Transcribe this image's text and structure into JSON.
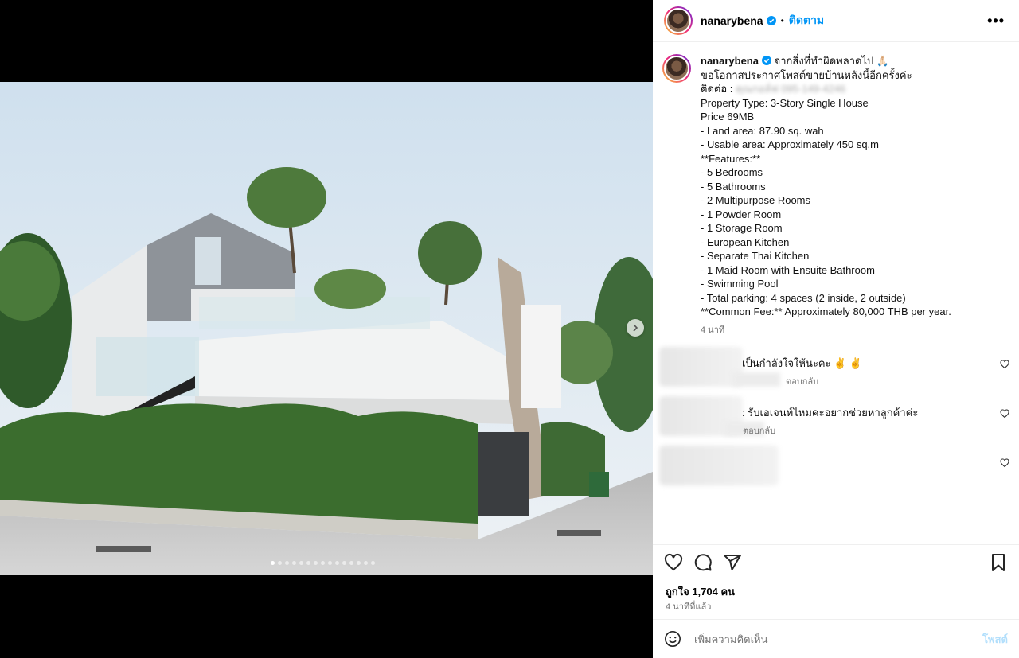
{
  "post": {
    "username": "nanarybena",
    "follow_label": "ติดตาม",
    "more_label": "•••",
    "dot_sep": "•"
  },
  "caption": {
    "lines": [
      "จากสิ่งที่ทำผิดพลาดไป 🙏🏻",
      "ขอโอกาสประกาศโพสต์ขายบ้านหลังนี้อีกครั้งค่ะ",
      "ติดต่อ :",
      "",
      "Property Type: 3-Story Single House",
      "Price 69MB",
      "",
      "- Land area: 87.90 sq. wah",
      "- Usable area: Approximately 450 sq.m",
      "",
      "**Features:**",
      "- 5 Bedrooms",
      "- 5 Bathrooms",
      "- 2 Multipurpose Rooms",
      "- 1 Powder Room",
      "- 1 Storage Room",
      "- European Kitchen",
      "- Separate Thai Kitchen",
      "- 1 Maid Room with Ensuite Bathroom",
      "- Swimming Pool",
      "- Total parking: 4 spaces (2 inside, 2 outside)",
      "",
      "**Common Fee:** Approximately 80,000 THB per year."
    ],
    "contact_blurred": "คุณกอล์ฟ 095-149-4246",
    "time": "4 นาที"
  },
  "comments": [
    {
      "text": "เป็นกำลังใจให้นะคะ ✌️ ✌️",
      "reply": "ตอบกลับ"
    },
    {
      "text": ": รับเอเจนท์ไหมคะอยากช่วยหาลูกค้าค่ะ",
      "reply": "ตอบกลับ"
    },
    {
      "text": "",
      "reply": ""
    }
  ],
  "stats": {
    "likes": "ถูกใจ 1,704 คน",
    "ago": "4 นาทีที่แล้ว"
  },
  "add_comment": {
    "placeholder": "เพิ่มความคิดเห็น",
    "post_label": "โพสต์"
  },
  "colors": {
    "accent": "#0095f6",
    "verified": "#0095f6",
    "post_disabled": "#b2dffc"
  },
  "icons": {
    "like": "heart-icon",
    "comment": "comment-icon",
    "share": "send-icon",
    "save": "bookmark-icon",
    "emoji": "emoji-icon",
    "next": "chevron-right-icon"
  }
}
